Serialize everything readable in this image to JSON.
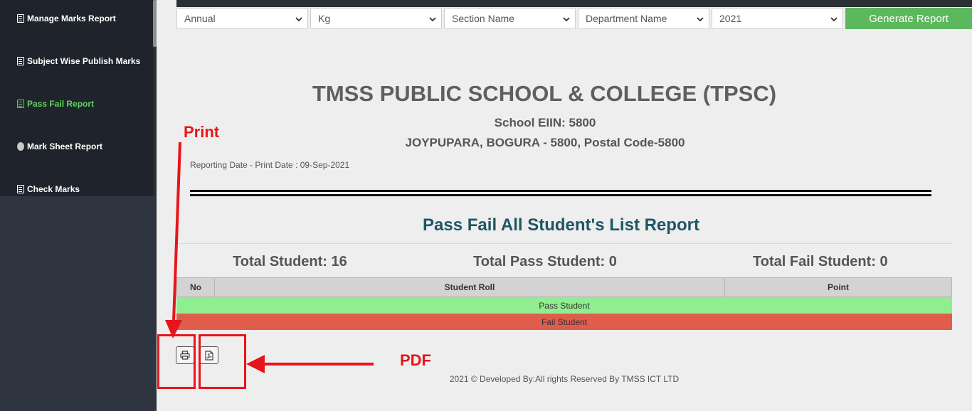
{
  "sidebar": {
    "items": [
      {
        "label": "Manage Marks Report",
        "icon": "document-icon",
        "active": false
      },
      {
        "label": "Subject Wise Publish Marks",
        "icon": "document-icon",
        "active": false
      },
      {
        "label": "Pass Fail Report",
        "icon": "document-icon",
        "active": true
      },
      {
        "label": "Mark Sheet Report",
        "icon": "circle-icon",
        "active": false
      },
      {
        "label": "Check Marks",
        "icon": "document-icon",
        "active": false
      }
    ],
    "active_color": "#5fd35f"
  },
  "filters": {
    "exam": "Annual",
    "class": "Kg",
    "section": "Section Name",
    "department": "Department Name",
    "year": "2021",
    "generate_label": "Generate Report",
    "generate_color": "#5cb85c"
  },
  "report": {
    "school_name": "TMSS PUBLIC SCHOOL & COLLEGE (TPSC)",
    "eiin": "School EIIN: 5800",
    "address": "JOYPUPARA, BOGURA - 5800, Postal Code-5800",
    "reporting_date": "Reporting Date - Print Date : 09-Sep-2021",
    "title": "Pass Fail All Student's List Report",
    "total_student": "Total Student: 16",
    "total_pass": "Total Pass Student: 0",
    "total_fail": "Total Fail Student: 0",
    "table": {
      "headers": [
        "No",
        "Student Roll",
        "Point"
      ],
      "pass_row": "Pass Student",
      "fail_row": "Fail Student"
    },
    "pass_color": "#90ee90",
    "fail_color": "#e05d4b"
  },
  "actions": {
    "print_icon": "printer-icon",
    "pdf_icon": "pdf-file-icon"
  },
  "footer": "2021 © Developed By:All rights Reserved By TMSS ICT LTD",
  "annotations": {
    "print_label": "Print",
    "pdf_label": "PDF",
    "color": "#e8141b"
  }
}
